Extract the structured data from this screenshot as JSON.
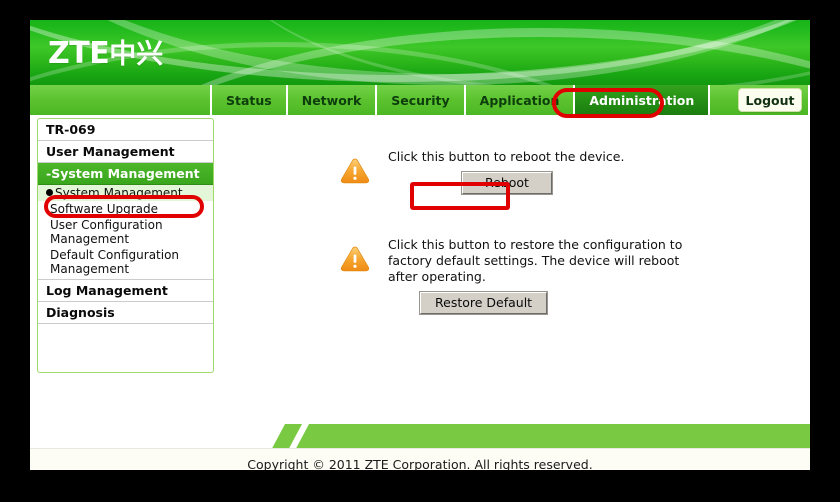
{
  "brand": {
    "logo_latin": "ZTE",
    "logo_cn": "中兴",
    "accent_green": "#3fc728",
    "nav_green": "#5cc32f",
    "active_green": "#259015",
    "band_green": "#7ac943",
    "annotation_red": "#e00000",
    "warning_orange": "#f7a933"
  },
  "nav": {
    "tabs": [
      {
        "label": "Status",
        "active": false
      },
      {
        "label": "Network",
        "active": false
      },
      {
        "label": "Security",
        "active": false
      },
      {
        "label": "Application",
        "active": false
      },
      {
        "label": "Administration",
        "active": true
      }
    ],
    "logout_label": "Logout"
  },
  "sidebar": {
    "items": [
      {
        "label": "TR-069",
        "type": "top",
        "state": "normal"
      },
      {
        "label": "User Management",
        "type": "top",
        "state": "normal"
      },
      {
        "label": "-System Management",
        "type": "top",
        "state": "expanded-active"
      },
      {
        "label": "System Management",
        "type": "sub",
        "state": "selected"
      },
      {
        "label": "Software Upgrade",
        "type": "sub",
        "state": "normal"
      },
      {
        "label": "User Configuration Management",
        "type": "sub",
        "state": "normal"
      },
      {
        "label": "Default Configuration Management",
        "type": "sub",
        "state": "normal"
      },
      {
        "label": "Log Management",
        "type": "top",
        "state": "normal"
      },
      {
        "label": "Diagnosis",
        "type": "top",
        "state": "normal"
      }
    ]
  },
  "main": {
    "sections": [
      {
        "icon": "warning-triangle-icon",
        "text": "Click this button to reboot the device.",
        "button_label": "Reboot",
        "annotated": true
      },
      {
        "icon": "warning-triangle-icon",
        "text": "Click this button to restore the configuration to factory default settings. The device will reboot after operating.",
        "button_label": "Restore Default",
        "annotated": false
      }
    ]
  },
  "footer": {
    "copyright": "Copyright © 2011 ZTE Corporation. All rights reserved."
  },
  "annotations": [
    {
      "target": "Administration",
      "shape": "rounded-rect"
    },
    {
      "target": "System Management",
      "shape": "rounded-rect"
    },
    {
      "target": "Reboot",
      "shape": "rect"
    }
  ]
}
